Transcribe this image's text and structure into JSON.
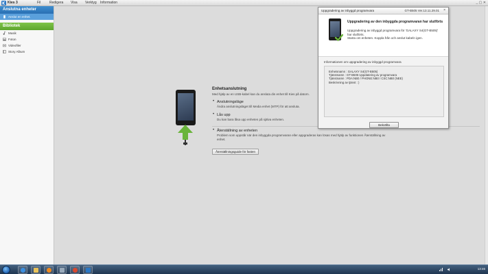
{
  "app": {
    "name": "Kies 3",
    "menu": [
      "Fil",
      "Redigera",
      "Visa",
      "Verktyg",
      "Information"
    ],
    "window_buttons": "_ ▢ ✕"
  },
  "sidebar": {
    "section1_title": "Anslutna enheter",
    "connected_device": "Anslut en enhet.",
    "section2_title": "Bibliotek",
    "items": [
      {
        "label": "Musik",
        "icon": "music-icon"
      },
      {
        "label": "Foton",
        "icon": "photo-icon"
      },
      {
        "label": "Videofiler",
        "icon": "video-icon"
      },
      {
        "label": "Story Album",
        "icon": "album-icon"
      }
    ]
  },
  "connection": {
    "heading": "Enhetsanslutning",
    "intro": "Med hjälp av en USB-kabel kan du ansluta din enhet till Kies på datorn.",
    "bullets": [
      {
        "title": "Anslutningsläge",
        "desc": "Ändra anslutningsläget till Media enhet (MTP) för att ansluta."
      },
      {
        "title": "Lås upp",
        "desc": "Du kan bara låsa upp enheten på själva enheten."
      },
      {
        "title": "Återställning av enheten",
        "desc": "Problem som uppstår när den inbyggda programvaran eller appgraderas kan lösas med hjälp av funktionen Återställning av enhet."
      }
    ],
    "restore_button": "Återställningsguide för fasten"
  },
  "dialog": {
    "title": "Uppgradering av inbyggd programvara",
    "version": "GT-B505 Ver.13.11.29.01",
    "close": "×",
    "heading": "Uppgradering av den inbyggda programvaran har slutförts",
    "message": [
      "Uppgradering av inbyggd programvara för 'GALAXY S4(GT-B505)'",
      "har slutförts.",
      "Starta om enheten. Koppla från och anslut kabeln igen."
    ],
    "info_label": "Informationen om uppgradering av inbyggd programvara",
    "info_lines": [
      "Enhetsnamn : GALAXY S4(GT-B505)",
      "Tjänstnamn : GT-B505 Uppdatering av programvara",
      "Tjänstnamn : PDA:NB0 / PHONE:NB0 / CSC:NB0 (NEE)",
      "Beskrivning av tjänst : )"
    ],
    "ok_button": "Bekräfta"
  },
  "taskbar": {
    "time": "13:46"
  },
  "colors": {
    "accent_blue": "#3e8ed0",
    "accent_green": "#6ab43a",
    "taskbar": "#2a4566"
  }
}
